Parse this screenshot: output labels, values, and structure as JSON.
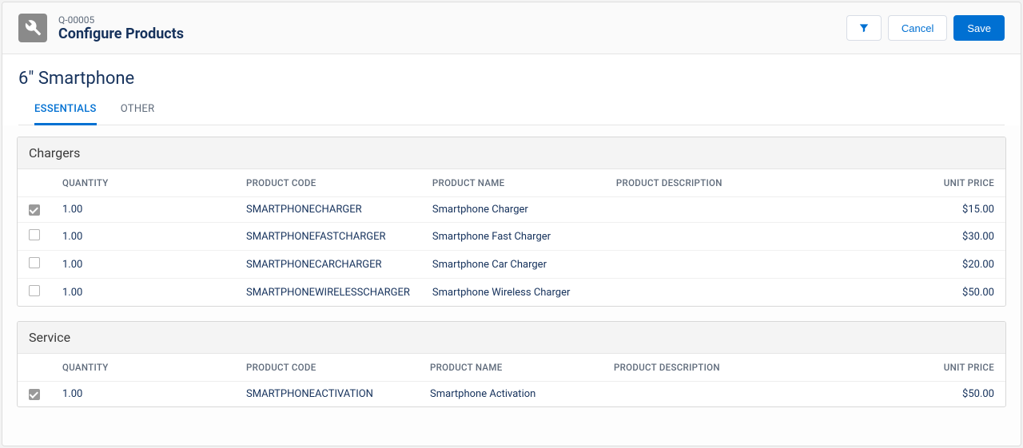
{
  "header": {
    "quote_id": "Q-00005",
    "page_title": "Configure Products",
    "actions": {
      "cancel": "Cancel",
      "save": "Save"
    }
  },
  "product_title": "6\" Smartphone",
  "tabs": [
    {
      "label": "ESSENTIALS",
      "active": true
    },
    {
      "label": "OTHER",
      "active": false
    }
  ],
  "columns": {
    "quantity": "QUANTITY",
    "product_code": "PRODUCT CODE",
    "product_name": "PRODUCT NAME",
    "product_description": "PRODUCT DESCRIPTION",
    "unit_price": "UNIT PRICE"
  },
  "groups": [
    {
      "title": "Chargers",
      "rows": [
        {
          "checked": true,
          "quantity": "1.00",
          "code": "SMARTPHONECHARGER",
          "name": "Smartphone Charger",
          "description": "",
          "price": "$15.00"
        },
        {
          "checked": false,
          "quantity": "1.00",
          "code": "SMARTPHONEFASTCHARGER",
          "name": "Smartphone Fast Charger",
          "description": "",
          "price": "$30.00"
        },
        {
          "checked": false,
          "quantity": "1.00",
          "code": "SMARTPHONECARCHARGER",
          "name": "Smartphone Car Charger",
          "description": "",
          "price": "$20.00"
        },
        {
          "checked": false,
          "quantity": "1.00",
          "code": "SMARTPHONEWIRELESSCHARGER",
          "name": "Smartphone Wireless Charger",
          "description": "",
          "price": "$50.00"
        }
      ]
    },
    {
      "title": "Service",
      "rows": [
        {
          "checked": true,
          "quantity": "1.00",
          "code": "SMARTPHONEACTIVATION",
          "name": "Smartphone Activation",
          "description": "",
          "price": "$50.00"
        }
      ]
    }
  ]
}
